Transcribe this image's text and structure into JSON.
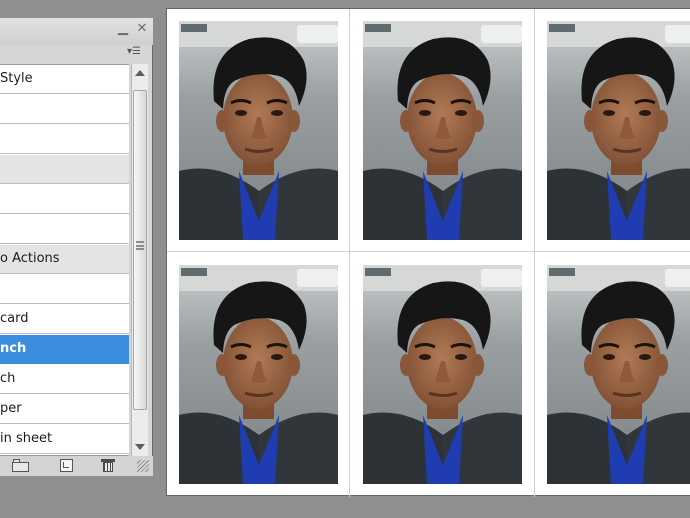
{
  "panel": {
    "window_controls": {
      "minimize": "▁",
      "close": "✕"
    },
    "menu_icon": "panel-menu-icon",
    "rows": [
      {
        "label": "Style",
        "grey": false
      },
      {
        "label": "",
        "grey": false
      },
      {
        "label": "",
        "grey": false
      },
      {
        "label": "",
        "grey": true
      },
      {
        "label": "",
        "grey": false
      },
      {
        "label": "",
        "grey": false
      },
      {
        "label": "o Actions",
        "grey": true
      },
      {
        "label": "",
        "grey": false
      },
      {
        "label": "card",
        "grey": false
      },
      {
        "label": "nch",
        "selected": true
      },
      {
        "label": "ch",
        "grey": false
      },
      {
        "label": "per",
        "grey": false
      },
      {
        "label": "in sheet",
        "grey": false
      }
    ],
    "bottom_icons": [
      "folder-icon",
      "new-action-icon",
      "trash-icon"
    ]
  },
  "canvas": {
    "photo_grid": {
      "rows": 2,
      "columns": 3,
      "photo_count": 6
    }
  },
  "colors": {
    "selection": "#3c8ce0",
    "panel_bg": "#d6d6d6",
    "workspace_bg": "#8f8f8f"
  }
}
